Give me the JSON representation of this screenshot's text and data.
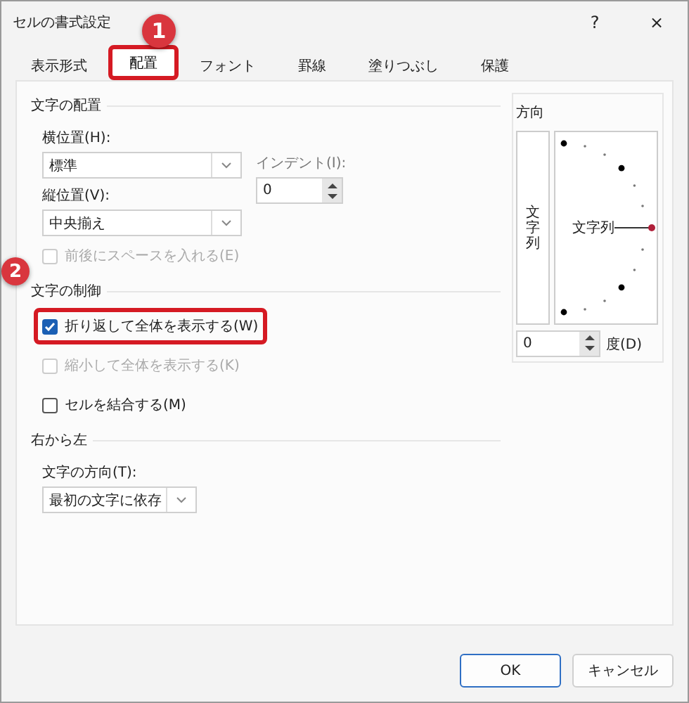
{
  "window": {
    "title": "セルの書式設定",
    "help": "?",
    "close": "×"
  },
  "tabs": [
    {
      "label": "表示形式",
      "selected": false,
      "highlighted": false
    },
    {
      "label": "配置",
      "selected": true,
      "highlighted": true
    },
    {
      "label": "フォント",
      "selected": false,
      "highlighted": false
    },
    {
      "label": "罫線",
      "selected": false,
      "highlighted": false
    },
    {
      "label": "塗りつぶし",
      "selected": false,
      "highlighted": false
    },
    {
      "label": "保護",
      "selected": false,
      "highlighted": false
    }
  ],
  "text_alignment": {
    "label": "文字の配置",
    "horizontal": {
      "label": "横位置(H):",
      "value": "標準"
    },
    "indent": {
      "label": "インデント(I):",
      "value": "0"
    },
    "vertical": {
      "label": "縦位置(V):",
      "value": "中央揃え"
    },
    "distributed": {
      "label": "前後にスペースを入れる(E)",
      "checked": false,
      "disabled": true,
      "highlighted": false
    }
  },
  "text_control": {
    "label": "文字の制御",
    "options": [
      {
        "label": "折り返して全体を表示する(W)",
        "checked": true,
        "disabled": false,
        "highlighted": true
      },
      {
        "label": "縮小して全体を表示する(K)",
        "checked": false,
        "disabled": true,
        "highlighted": false
      },
      {
        "label": "セルを結合する(M)",
        "checked": false,
        "disabled": false,
        "highlighted": false
      }
    ]
  },
  "right_to_left": {
    "label": "右から左",
    "direction": {
      "label": "文字の方向(T):",
      "value": "最初の文字に依存"
    }
  },
  "orientation": {
    "label": "方向",
    "vertical_text": "文字列",
    "dial_text": "文字列",
    "degrees": "0",
    "unit": "度(D)"
  },
  "annotations": [
    {
      "number": "1"
    },
    {
      "number": "2"
    }
  ],
  "buttons": [
    {
      "label": "OK",
      "default": true
    },
    {
      "label": "キャンセル",
      "default": false
    }
  ]
}
